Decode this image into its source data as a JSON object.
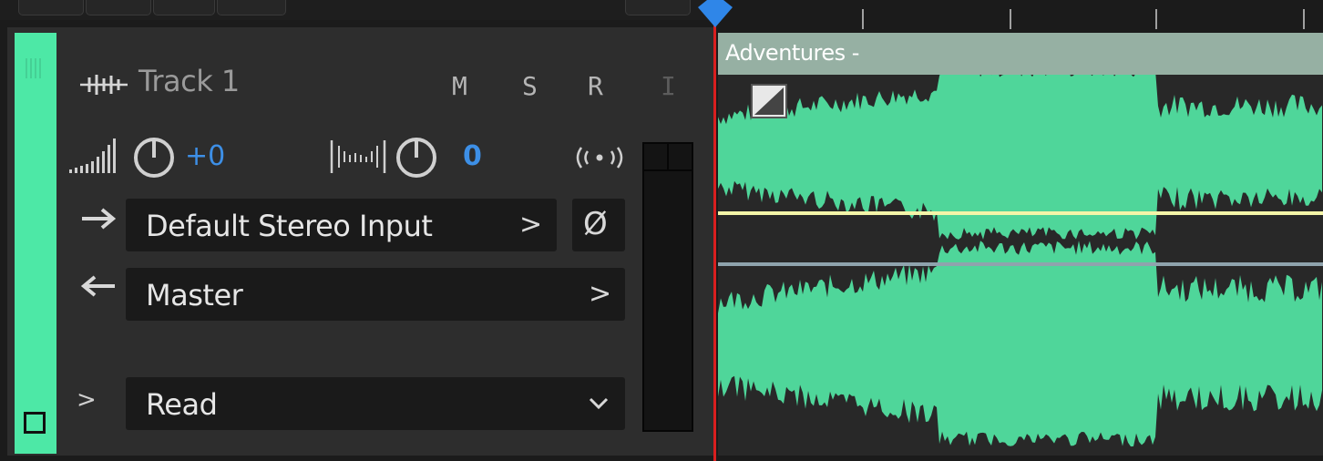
{
  "track": {
    "name": "Track 1",
    "mute_label": "M",
    "solo_label": "S",
    "record_label": "R",
    "input_monitor_label": "I",
    "volume_value": "+0",
    "pan_value": "0"
  },
  "routing": {
    "input": "Default Stereo Input",
    "output": "Master",
    "phase_symbol": "Ø",
    "chevron": ">"
  },
  "automation": {
    "mode": "Read",
    "expand_chevron": ">"
  },
  "clip": {
    "title": "Adventures -"
  },
  "colors": {
    "track": "#4de8a6",
    "waveform": "#4fd69a",
    "clip_header": "#96b0a3",
    "accent_blue": "#3d8fe6",
    "playhead": "#d91f1f",
    "volume_line": "#f4f5a8",
    "pan_line": "#8fa3ad"
  }
}
